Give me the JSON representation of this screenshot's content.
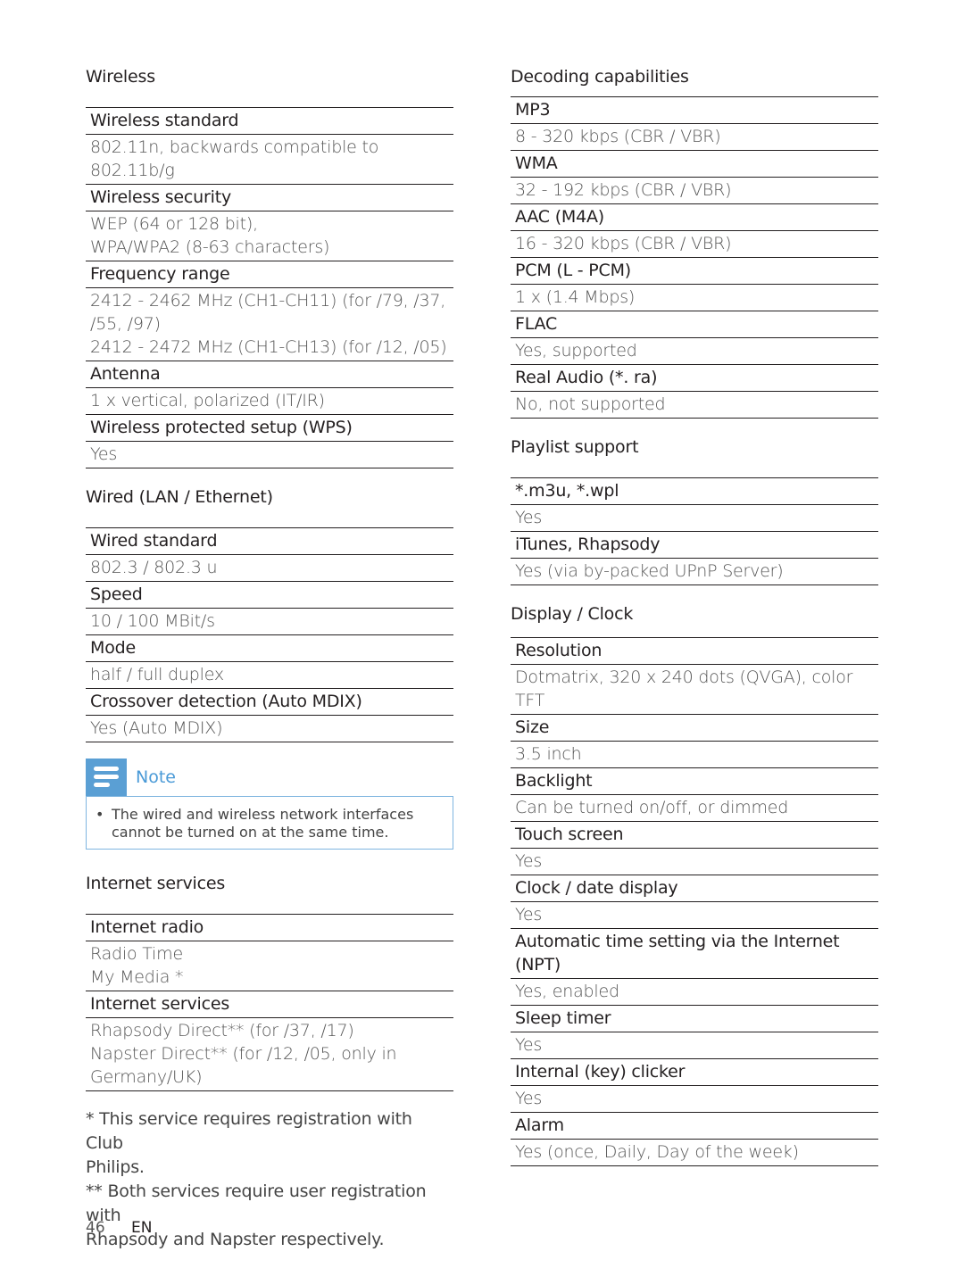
{
  "left": {
    "wireless": {
      "title": "Wireless",
      "rows": [
        {
          "h": "Wireless standard",
          "v": "802.11n, backwards compatible to 802.11b/g"
        },
        {
          "h": "Wireless security",
          "v": "WEP (64 or 128 bit),\nWPA/WPA2 (8-63 characters)"
        },
        {
          "h": "Frequency range",
          "v": "2412 - 2462 MHz (CH1-CH11) (for /79, /37,\n/55, /97)\n2412 - 2472 MHz (CH1-CH13) (for /12, /05)"
        },
        {
          "h": "Antenna",
          "v": "1 x vertical, polarized (IT/IR)"
        },
        {
          "h": "Wireless protected setup (WPS)",
          "v": "Yes"
        }
      ]
    },
    "wired": {
      "title": "Wired (LAN / Ethernet)",
      "rows": [
        {
          "h": "Wired standard",
          "v": "802.3 / 802.3 u"
        },
        {
          "h": "Speed",
          "v": "10 / 100 MBit/s"
        },
        {
          "h": "Mode",
          "v": "half / full duplex"
        },
        {
          "h": "Crossover detection (Auto MDIX)",
          "v": "Yes (Auto MDIX)"
        }
      ]
    },
    "note": {
      "title": "Note",
      "bullet": "•",
      "text": "The wired and wireless network interfaces cannot be turned on at the same time."
    },
    "internet": {
      "title": "Internet services",
      "rows": [
        {
          "h": "Internet radio",
          "v": "Radio Time\nMy Media *"
        },
        {
          "h": "Internet services",
          "v": "Rhapsody Direct** (for /37, /17)\nNapster Direct** (for /12, /05, only in\nGermany/UK)"
        }
      ]
    },
    "footnotes": "* This service requires registration with Club\nPhilips.\n** Both services require user registration with\nRhapsody and Napster respectively."
  },
  "right": {
    "decoding": {
      "title": "Decoding capabilities",
      "rows": [
        {
          "h": "MP3",
          "v": "8 - 320 kbps (CBR / VBR)"
        },
        {
          "h": "WMA",
          "v": "32 - 192 kbps (CBR / VBR)"
        },
        {
          "h": "AAC (M4A)",
          "v": "16 - 320 kbps (CBR / VBR)"
        },
        {
          "h": "PCM (L - PCM)",
          "v": "1 x (1.4 Mbps)"
        },
        {
          "h": "FLAC",
          "v": "Yes, supported"
        },
        {
          "h": "Real Audio (*. ra)",
          "v": "No, not supported"
        }
      ]
    },
    "playlist": {
      "title": "Playlist support",
      "rows": [
        {
          "h": "*.m3u, *.wpl",
          "v": "Yes"
        },
        {
          "h": "iTunes, Rhapsody",
          "v": "Yes (via by-packed UPnP Server)"
        }
      ]
    },
    "display": {
      "title": "Display / Clock",
      "rows": [
        {
          "h": "Resolution",
          "v": "Dotmatrix, 320 x 240 dots (QVGA), color\nTFT"
        },
        {
          "h": "Size",
          "v": "3.5 inch"
        },
        {
          "h": "Backlight",
          "v": "Can be turned on/off, or dimmed"
        },
        {
          "h": "Touch screen",
          "v": "Yes"
        },
        {
          "h": "Clock / date display",
          "v": "Yes"
        },
        {
          "h": "Automatic time setting via the Internet\n(NPT)",
          "v": "Yes, enabled"
        },
        {
          "h": "Sleep timer",
          "v": "Yes"
        },
        {
          "h": "Internal (key) clicker",
          "v": "Yes"
        },
        {
          "h": "Alarm",
          "v": "Yes (once, Daily, Day of the week)"
        }
      ]
    }
  },
  "footer": {
    "page_number": "46",
    "language": "EN"
  }
}
